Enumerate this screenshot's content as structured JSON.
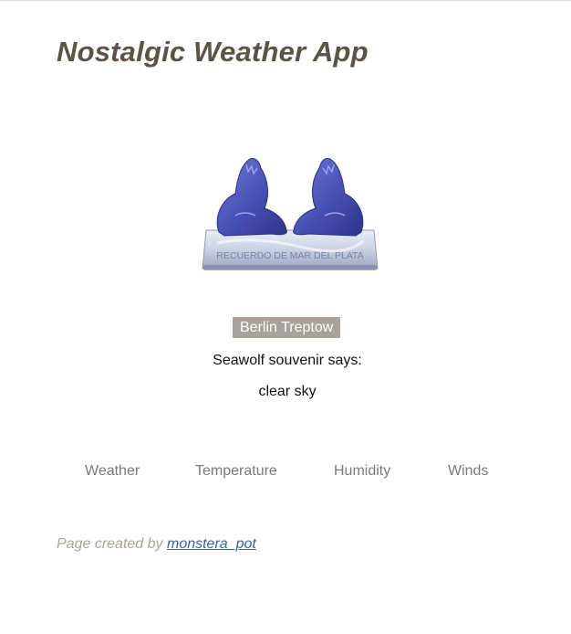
{
  "header": {
    "title": "Nostalgic Weather App"
  },
  "souvenir": {
    "image_icon": "seawolf-souvenir-figurine",
    "base_inscription": "RECUERDO DE MAR DEL PLATA"
  },
  "weather": {
    "location": "Berlin Treptow",
    "says_label": "Seawolf souvenir says:",
    "condition": "clear sky"
  },
  "tabs": [
    {
      "label": "Weather"
    },
    {
      "label": "Temperature"
    },
    {
      "label": "Humidity"
    },
    {
      "label": "Winds"
    }
  ],
  "footer": {
    "prefix": "Page created by",
    "author_link": "monstera_pot"
  },
  "colors": {
    "title": "#5a5346",
    "badge_bg": "#a7a39a",
    "tab_text": "#7a7a7a",
    "footer_text": "#aaa59c",
    "link": "#3b5ea8"
  }
}
